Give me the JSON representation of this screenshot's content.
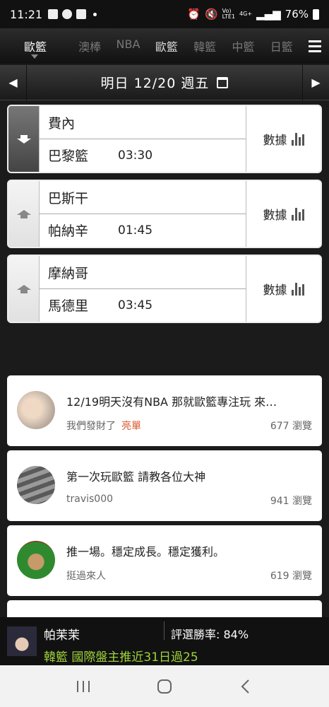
{
  "status_bar": {
    "time": "11:21",
    "network": "4G+",
    "network_sub": "LTE1",
    "volte": "Vo)",
    "battery": "76%"
  },
  "tabs": {
    "current": "歐籃",
    "items": [
      "澳棒",
      "NBA",
      "歐籃",
      "韓籃",
      "中籃",
      "日籃"
    ],
    "active_index": 2
  },
  "datebar": {
    "prev": "◀",
    "label": "明日 12/20 週五",
    "next": "▶"
  },
  "matches": [
    {
      "home": "費內",
      "away": "巴黎籃",
      "time": "03:30",
      "data_label": "數據",
      "direction": "down"
    },
    {
      "home": "巴斯干",
      "away": "帕納辛",
      "time": "01:45",
      "data_label": "數據",
      "direction": "up"
    },
    {
      "home": "摩納哥",
      "away": "馬德里",
      "time": "03:45",
      "data_label": "數據",
      "direction": "up"
    }
  ],
  "posts": [
    {
      "title": "12/19明天沒有NBA 那就歐籃專注玩 來…",
      "author": "我們發財了",
      "tag": "亮單",
      "views": "677 瀏覽"
    },
    {
      "title": "第一次玩歐籃 請教各位大神",
      "author": "travis000",
      "tag": "",
      "views": "941 瀏覽"
    },
    {
      "title": "推一場。穩定成長。穩定獲利。",
      "author": "挺過來人",
      "tag": "",
      "views": "619 瀏覽"
    }
  ],
  "banner": {
    "name": "帕茉茉",
    "rate": "評選勝率: 84%",
    "promo": "韓籃 國際盤主推近31日過25"
  },
  "colors": {
    "accent_green": "#9fd33a",
    "tag_orange": "#d9552b"
  }
}
